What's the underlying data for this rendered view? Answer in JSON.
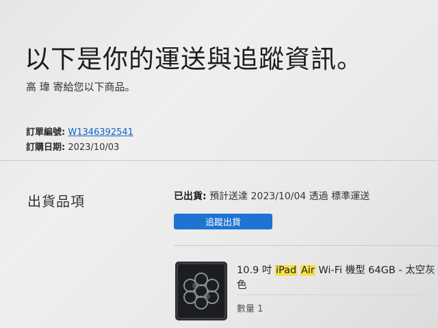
{
  "header": {
    "title": "以下是你的運送與追蹤資訊。",
    "sender_line": "高 瑋 寄給您以下商品。"
  },
  "order": {
    "number_label": "訂單編號:",
    "number_value": "W1346392541",
    "date_label": "訂購日期:",
    "date_value": "2023/10/03"
  },
  "shipment": {
    "section_title": "出貨品項",
    "status_label": "已出貨:",
    "status_detail": "預計送達 2023/10/04 透過 標準運送",
    "track_button": "追蹤出貨"
  },
  "item": {
    "name_prefix": "10.9 吋 ",
    "name_highlight_1": "iPad",
    "name_space": " ",
    "name_highlight_2": "Air",
    "name_suffix": " Wi-Fi 機型 64GB - 太空灰色",
    "quantity": "數量 1"
  },
  "colors": {
    "accent_blue": "#1f73d1",
    "link_blue": "#0a63c6",
    "highlight": "#f5df4d"
  }
}
